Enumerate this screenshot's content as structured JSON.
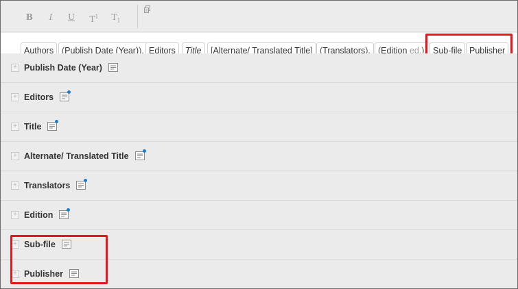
{
  "toolbar": {
    "bold": "B",
    "italic": "I",
    "underline": "U",
    "superscript_base": "T",
    "superscript_mark": "1",
    "subscript_base": "T",
    "subscript_mark": "1",
    "copy_icon": "copy-icon"
  },
  "chips": [
    {
      "label": "Authors",
      "prefix": "",
      "suffix": "",
      "italic": false
    },
    {
      "label": "Publish Date (Year)",
      "prefix": "(",
      "suffix": ").",
      "italic": false
    },
    {
      "label": "Editors",
      "prefix": "",
      "suffix": "",
      "italic": false
    },
    {
      "label": "Title",
      "prefix": "",
      "suffix": "",
      "italic": true
    },
    {
      "label": "Alternate/ Translated Title",
      "prefix": "[",
      "suffix": "]",
      "italic": false
    },
    {
      "label": "Translators",
      "prefix": "(",
      "suffix": ").",
      "italic": false
    },
    {
      "label": "Edition",
      "prefix": "(",
      "suffix": ").",
      "italic": false,
      "muted_suffix": "ed."
    },
    {
      "label": "Sub-file",
      "prefix": "",
      "suffix": "",
      "italic": false
    },
    {
      "label": "Publisher",
      "prefix": "",
      "suffix": "",
      "italic": false
    }
  ],
  "fields": [
    {
      "label": "Publish Date (Year)",
      "has_dot": false
    },
    {
      "label": "Editors",
      "has_dot": true
    },
    {
      "label": "Title",
      "has_dot": true
    },
    {
      "label": "Alternate/ Translated Title",
      "has_dot": true
    },
    {
      "label": "Translators",
      "has_dot": true
    },
    {
      "label": "Edition",
      "has_dot": true
    },
    {
      "label": "Sub-file",
      "has_dot": false
    },
    {
      "label": "Publisher",
      "has_dot": false
    }
  ],
  "colors": {
    "highlight": "#e8151b",
    "dot": "#1b7fd1",
    "background": "#ebebeb"
  }
}
